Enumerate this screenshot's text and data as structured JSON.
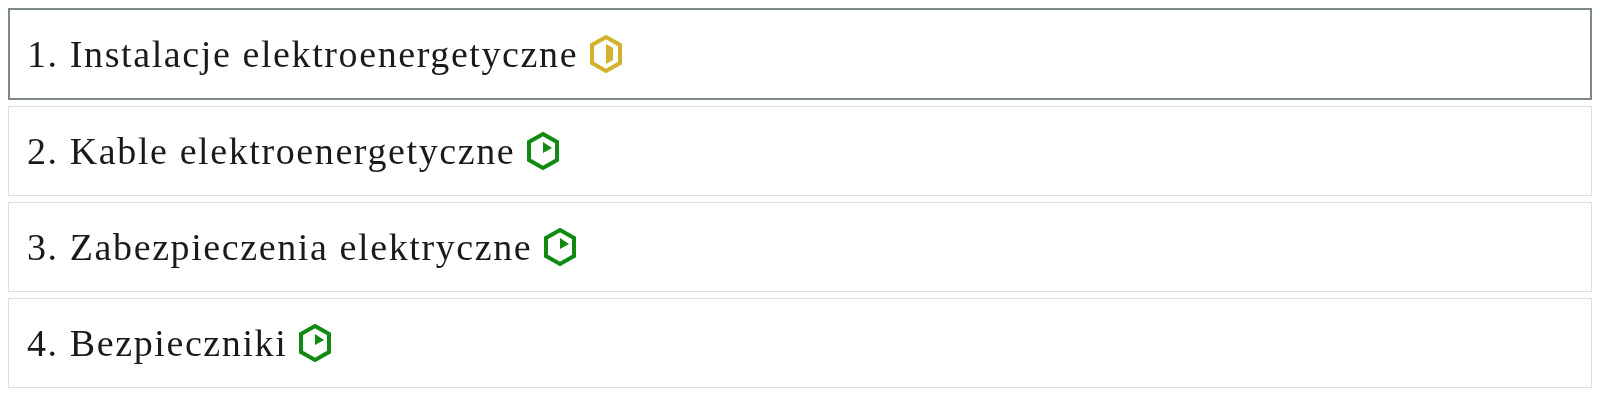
{
  "lessons": [
    {
      "title": "1. Instalacje elektroenergetyczne",
      "kind": "half",
      "selected": true
    },
    {
      "title": "2. Kable elektroenergetyczne",
      "kind": "play",
      "selected": false
    },
    {
      "title": "3. Zabezpieczenia elektryczne",
      "kind": "play",
      "selected": false
    },
    {
      "title": "4. Bezpieczniki",
      "kind": "play",
      "selected": false
    }
  ]
}
